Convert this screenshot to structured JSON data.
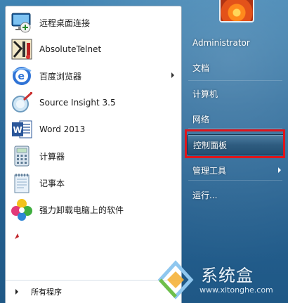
{
  "programs": [
    {
      "label": "远程桌面连接",
      "icon": "remote-desktop-icon",
      "has_arrow": false
    },
    {
      "label": "AbsoluteTelnet",
      "icon": "absolutetelnet-icon",
      "has_arrow": false
    },
    {
      "label": "百度浏览器",
      "icon": "baidu-browser-icon",
      "has_arrow": true
    },
    {
      "label": "Source Insight 3.5",
      "icon": "source-insight-icon",
      "has_arrow": false
    },
    {
      "label": "Word 2013",
      "icon": "word-icon",
      "has_arrow": false
    },
    {
      "label": "计算器",
      "icon": "calculator-icon",
      "has_arrow": false
    },
    {
      "label": "记事本",
      "icon": "notepad-icon",
      "has_arrow": false
    },
    {
      "label": "强力卸载电脑上的软件",
      "icon": "uninstaller-icon",
      "has_arrow": false
    }
  ],
  "all_programs_label": "所有程序",
  "right_items": [
    {
      "label": "Administrator",
      "has_arrow": false,
      "highlight": false
    },
    {
      "label": "文档",
      "has_arrow": false,
      "highlight": false
    },
    {
      "label": "计算机",
      "has_arrow": false,
      "highlight": false
    },
    {
      "label": "网络",
      "has_arrow": false,
      "highlight": false
    },
    {
      "label": "控制面板",
      "has_arrow": false,
      "highlight": true
    },
    {
      "label": "管理工具",
      "has_arrow": true,
      "highlight": false
    },
    {
      "label": "运行...",
      "has_arrow": false,
      "highlight": false
    }
  ],
  "watermark": {
    "brand": "系统盒",
    "url": "www.xitonghe.com"
  },
  "colors": {
    "highlight_border": "#e0151b",
    "panel_blue": "#2d6c9c"
  }
}
